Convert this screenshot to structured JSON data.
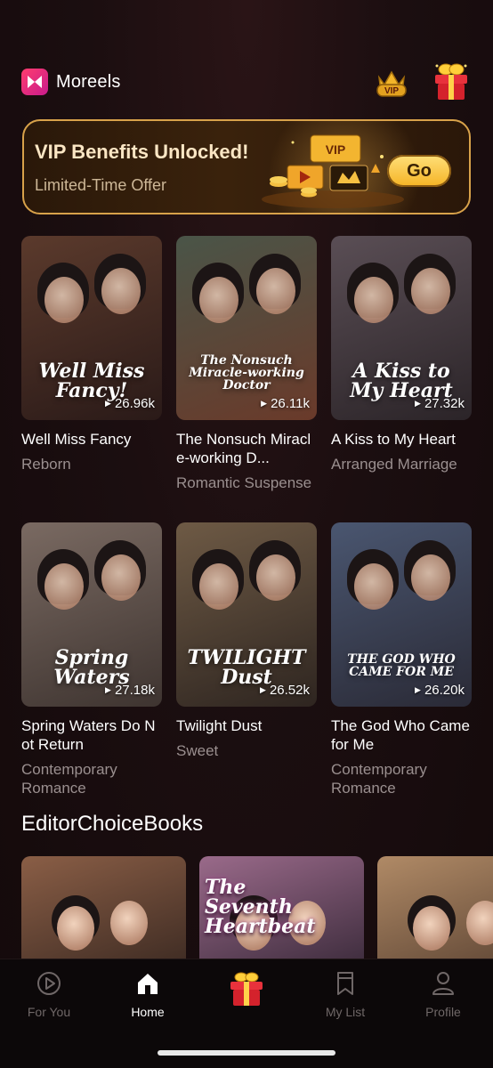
{
  "header": {
    "brand_name": "Moreels",
    "vip_icon": "vip-crown-icon",
    "gift_icon": "gift-icon"
  },
  "banner": {
    "title": "VIP Benefits Unlocked!",
    "subtitle": "Limited-Time Offer",
    "art_label": "VIP",
    "button_label": "Go"
  },
  "dramas": [
    {
      "poster_text": "Well Miss Fancy!",
      "views": "26.96k",
      "title": "Well Miss Fancy",
      "genre": "Reborn",
      "colors": [
        "#5b3a2c",
        "#2a1a18"
      ]
    },
    {
      "poster_text": "The Nonsuch Miracle-working Doctor",
      "views": "26.11k",
      "title": "The Nonsuch Miracle-working D...",
      "genre": "Romantic Suspense",
      "colors": [
        "#4a5548",
        "#6a3a2a"
      ]
    },
    {
      "poster_text": "A Kiss to My Heart",
      "views": "27.32k",
      "title": "A Kiss to My Heart",
      "genre": "Arranged Marriage",
      "colors": [
        "#5a4e55",
        "#2b2428"
      ]
    },
    {
      "poster_text": "Spring Waters",
      "views": "27.18k",
      "title": "Spring Waters Do Not Return",
      "genre": "Contemporary Romance",
      "colors": [
        "#7a6a62",
        "#3e3430"
      ]
    },
    {
      "poster_text": "TWILIGHT Dust",
      "views": "26.52k",
      "title": "Twilight Dust",
      "genre": "Sweet",
      "colors": [
        "#6e5a45",
        "#2e2520"
      ]
    },
    {
      "poster_text": "THE GOD WHO CAME FOR ME",
      "views": "26.20k",
      "title": "The God Who Came for Me",
      "genre": "Contemporary Romance",
      "colors": [
        "#4a5670",
        "#2a2a36"
      ]
    }
  ],
  "editor": {
    "title": "EditorChoiceBooks",
    "cards": [
      {
        "poster_text": "",
        "colors": [
          "#8a5e46",
          "#3c2a22"
        ]
      },
      {
        "poster_text": "The Seventh Heartbeat",
        "colors": [
          "#9a6a8a",
          "#3a2a3a"
        ]
      },
      {
        "poster_text": "",
        "colors": [
          "#b08a66",
          "#5a4232"
        ]
      }
    ]
  },
  "nav": {
    "items": [
      {
        "label": "For You",
        "icon": "play-circle-icon",
        "active": false
      },
      {
        "label": "Home",
        "icon": "home-icon",
        "active": true
      },
      {
        "label": "",
        "icon": "gift-icon",
        "active": false
      },
      {
        "label": "My List",
        "icon": "bookmark-icon",
        "active": false
      },
      {
        "label": "Profile",
        "icon": "profile-icon",
        "active": false
      }
    ]
  }
}
